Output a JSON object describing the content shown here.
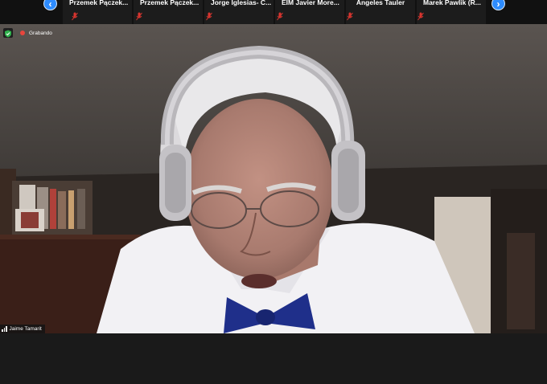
{
  "strip": {
    "prev_icon": "chevron-left-icon",
    "next_icon": "chevron-right-icon",
    "participants": [
      {
        "name": "Przemek  Pączek..."
      },
      {
        "name": "Przemek  Pączek..."
      },
      {
        "name": "Jorge Iglesias- C..."
      },
      {
        "name": "EIM Javier More..."
      },
      {
        "name": "Angeles Tauler"
      },
      {
        "name": "Marek  Pawlik  (R..."
      }
    ]
  },
  "recording": {
    "label": "Grabando",
    "security_icon": "shield-icon",
    "rec_color": "#e8453c"
  },
  "speaker": {
    "name": "Jaime Tamarit"
  },
  "colors": {
    "accent": "#2d8cff",
    "muted": "#d8352f"
  }
}
